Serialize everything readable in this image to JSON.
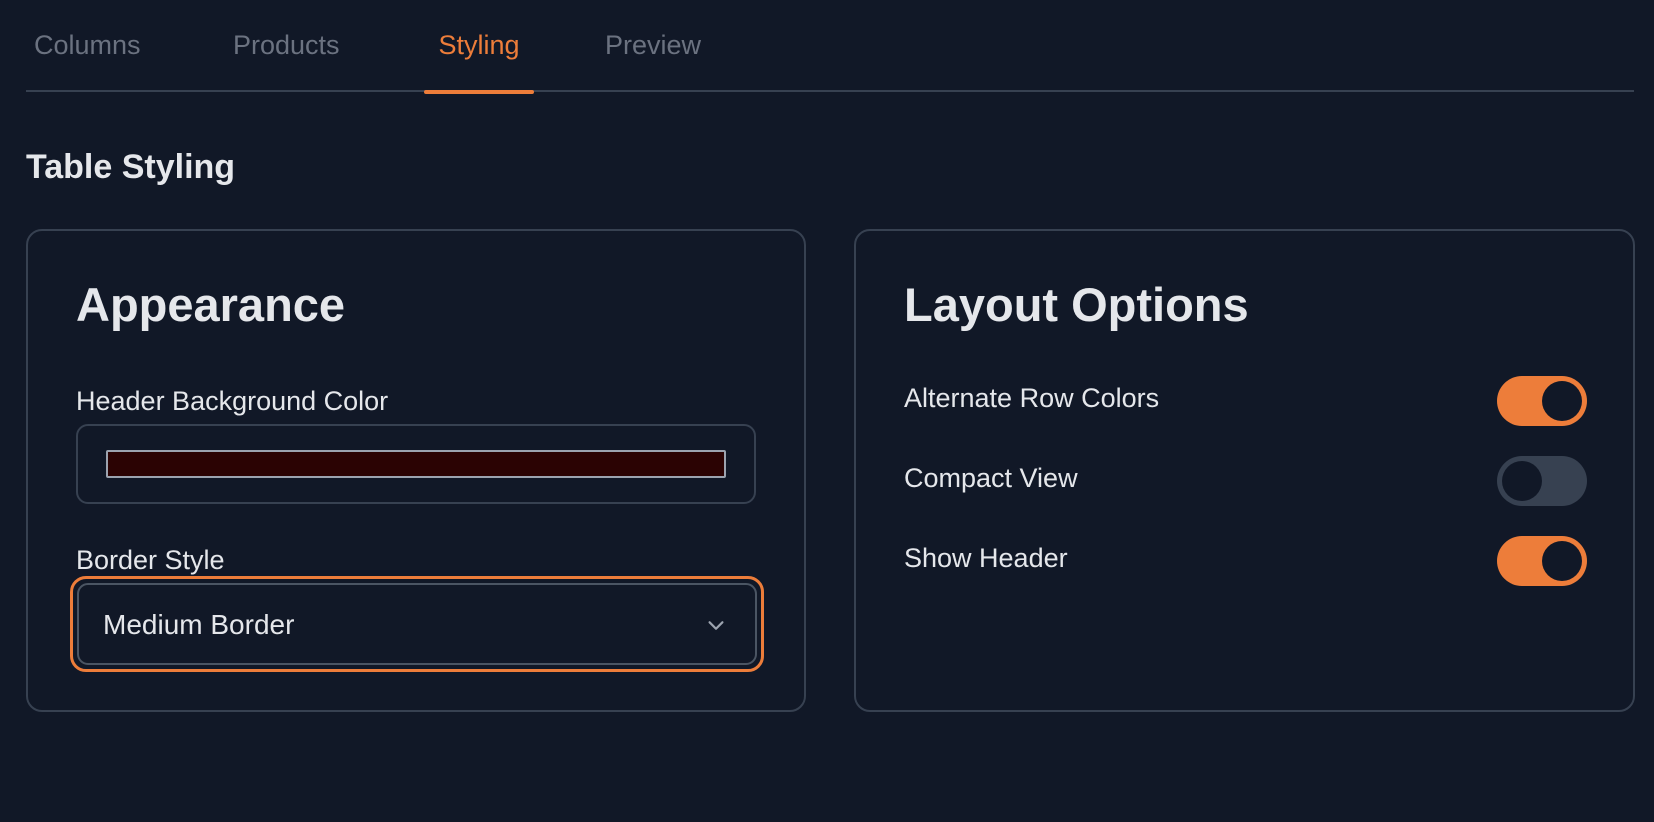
{
  "tabs": [
    {
      "label": "Columns",
      "active": false
    },
    {
      "label": "Products",
      "active": false
    },
    {
      "label": "Styling",
      "active": true
    },
    {
      "label": "Preview",
      "active": false
    }
  ],
  "section_title": "Table Styling",
  "appearance": {
    "title": "Appearance",
    "header_bg_label": "Header Background Color",
    "header_bg_color": "#2b0303",
    "border_style_label": "Border Style",
    "border_style_value": "Medium Border"
  },
  "layout": {
    "title": "Layout Options",
    "options": [
      {
        "label": "Alternate Row Colors",
        "enabled": true
      },
      {
        "label": "Compact View",
        "enabled": false
      },
      {
        "label": "Show Header",
        "enabled": true
      }
    ]
  },
  "colors": {
    "accent": "#ed7d3a",
    "background": "#111827",
    "border": "#374151"
  },
  "icons": {
    "select_chevron": "chevron-down-icon"
  }
}
